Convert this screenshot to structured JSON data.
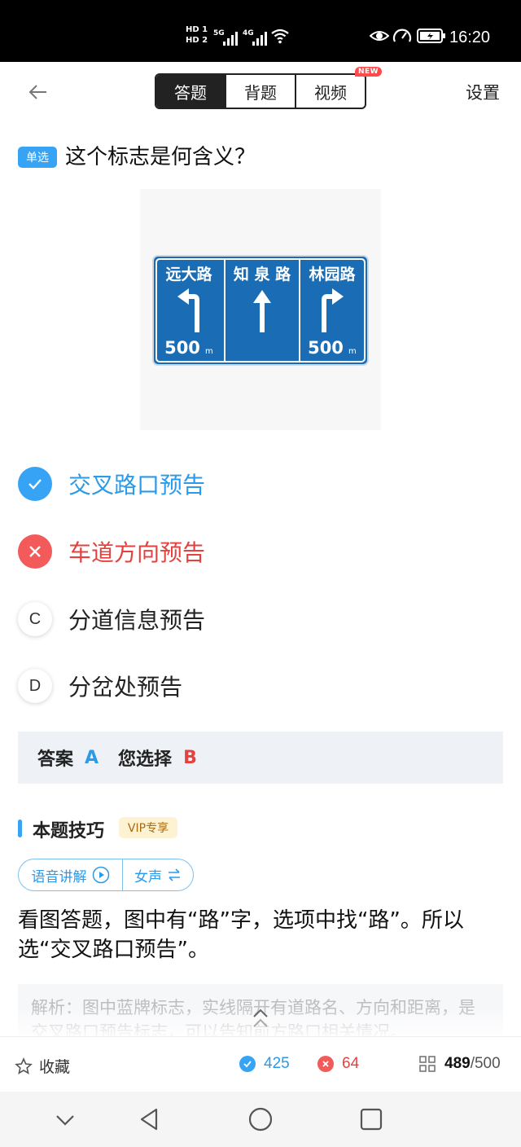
{
  "status_bar": {
    "hd1": "HD 1",
    "hd2": "HD 2",
    "net1": "5G",
    "net2": "4G",
    "time": "16:20",
    "icons": [
      "wifi-icon",
      "eye-icon",
      "speedometer-icon",
      "battery-icon"
    ]
  },
  "header": {
    "tabs": [
      {
        "label": "答题",
        "active": true
      },
      {
        "label": "背题",
        "active": false
      },
      {
        "label": "视频",
        "active": false
      }
    ],
    "new_badge": "NEW",
    "settings_label": "设置"
  },
  "question": {
    "type_label": "单选",
    "text": "这个标志是何含义？",
    "sign": {
      "panels": [
        {
          "road": "远大路",
          "direction": "left-turn",
          "distance": "500",
          "unit": "m"
        },
        {
          "road": "知 泉 路",
          "direction": "straight",
          "distance": "",
          "unit": ""
        },
        {
          "road": "林园路",
          "direction": "right-turn",
          "distance": "500",
          "unit": "m"
        }
      ]
    }
  },
  "options": [
    {
      "letter": "A",
      "text": "交叉路口预告",
      "state": "correct"
    },
    {
      "letter": "B",
      "text": "车道方向预告",
      "state": "wrong"
    },
    {
      "letter": "C",
      "text": "分道信息预告",
      "state": "normal"
    },
    {
      "letter": "D",
      "text": "分岔处预告",
      "state": "normal"
    }
  ],
  "answer": {
    "label": "答案",
    "correct": "A",
    "chosen_label": "您选择",
    "chosen": "B"
  },
  "tips": {
    "title": "本题技巧",
    "vip_label": "VIP专享",
    "voice_label": "语音讲解",
    "voice_gender": "女声",
    "text": "看图答题，图中有“路”字，选项中找“路”。所以选“交叉路口预告”。",
    "analysis": "解析：图中蓝牌标志，实线隔开有道路名、方向和距离，是交叉路口预告标志，可以告知前方路口相关情况。"
  },
  "bottom_bar": {
    "favorite_label": "收藏",
    "correct_count": "425",
    "wrong_count": "64",
    "progress_current": "489",
    "progress_total": "/500"
  },
  "colors": {
    "accent_blue": "#36a3f5",
    "wrong_red": "#f35a5a",
    "sign_blue": "#1a6db5"
  }
}
